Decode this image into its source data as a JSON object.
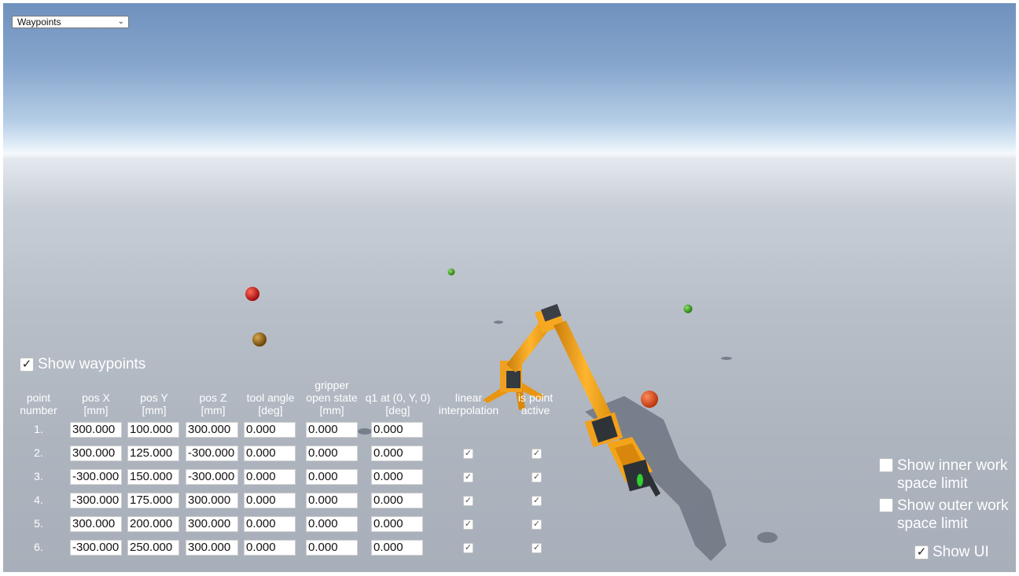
{
  "dropdown": {
    "selected": "Waypoints"
  },
  "show_waypoints": {
    "label": "Show waypoints",
    "checked": true
  },
  "table": {
    "headers": [
      "point\nnumber",
      "pos X\n[mm]",
      "pos Y\n[mm]",
      "pos Z\n[mm]",
      "tool angle\n[deg]",
      "gripper\nopen state\n[mm]",
      "q1 at (0, Y, 0)\n[deg]",
      "linear\ninterpolation",
      "is point\nactive"
    ],
    "rows": [
      {
        "num": "1.",
        "x": "300.000",
        "y": "100.000",
        "z": "300.000",
        "tool": "0.000",
        "grip": "0.000",
        "q1": "0.000",
        "linear": null,
        "active": null
      },
      {
        "num": "2.",
        "x": "300.000",
        "y": "125.000",
        "z": "-300.000",
        "tool": "0.000",
        "grip": "0.000",
        "q1": "0.000",
        "linear": true,
        "active": true
      },
      {
        "num": "3.",
        "x": "-300.000",
        "y": "150.000",
        "z": "-300.000",
        "tool": "0.000",
        "grip": "0.000",
        "q1": "0.000",
        "linear": true,
        "active": true
      },
      {
        "num": "4.",
        "x": "-300.000",
        "y": "175.000",
        "z": "300.000",
        "tool": "0.000",
        "grip": "0.000",
        "q1": "0.000",
        "linear": true,
        "active": true
      },
      {
        "num": "5.",
        "x": "300.000",
        "y": "200.000",
        "z": "300.000",
        "tool": "0.000",
        "grip": "0.000",
        "q1": "0.000",
        "linear": true,
        "active": true
      },
      {
        "num": "6.",
        "x": "-300.000",
        "y": "250.000",
        "z": "300.000",
        "tool": "0.000",
        "grip": "0.000",
        "q1": "0.000",
        "linear": true,
        "active": true
      }
    ]
  },
  "options": {
    "inner_limit": {
      "line1": "Show inner work",
      "line2": "space limit",
      "checked": false
    },
    "outer_limit": {
      "line1": "Show outer work",
      "line2": "space limit",
      "checked": false
    },
    "show_ui": {
      "label": "Show UI",
      "checked": true
    }
  },
  "scene": {
    "robot_color": "#f5a623",
    "waypoint_colors": [
      "#d42020",
      "#9a6a10",
      "#3aa020",
      "#40c030",
      "#e0501c"
    ]
  }
}
